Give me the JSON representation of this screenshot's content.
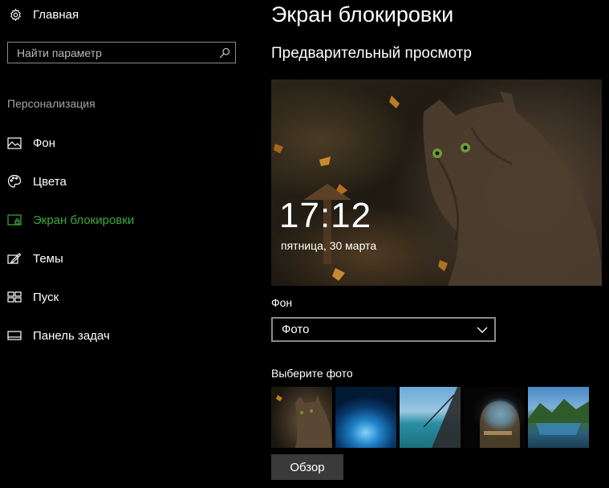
{
  "sidebar": {
    "home_label": "Главная",
    "search_placeholder": "Найти параметр",
    "section_label": "Персонализация",
    "items": [
      {
        "label": "Фон",
        "icon": "picture-icon",
        "active": false
      },
      {
        "label": "Цвета",
        "icon": "palette-icon",
        "active": false
      },
      {
        "label": "Экран блокировки",
        "icon": "lock-screen-icon",
        "active": true
      },
      {
        "label": "Темы",
        "icon": "themes-icon",
        "active": false
      },
      {
        "label": "Пуск",
        "icon": "start-icon",
        "active": false
      },
      {
        "label": "Панель задач",
        "icon": "taskbar-icon",
        "active": false
      }
    ],
    "accent_color": "#3fa83b"
  },
  "main": {
    "title": "Экран блокировки",
    "preview_title": "Предварительный просмотр",
    "preview_time": "17:12",
    "preview_date": "пятница, 30 марта",
    "background_label": "Фон",
    "background_value": "Фото",
    "choose_photo_label": "Выберите фото",
    "browse_label": "Обзор"
  }
}
